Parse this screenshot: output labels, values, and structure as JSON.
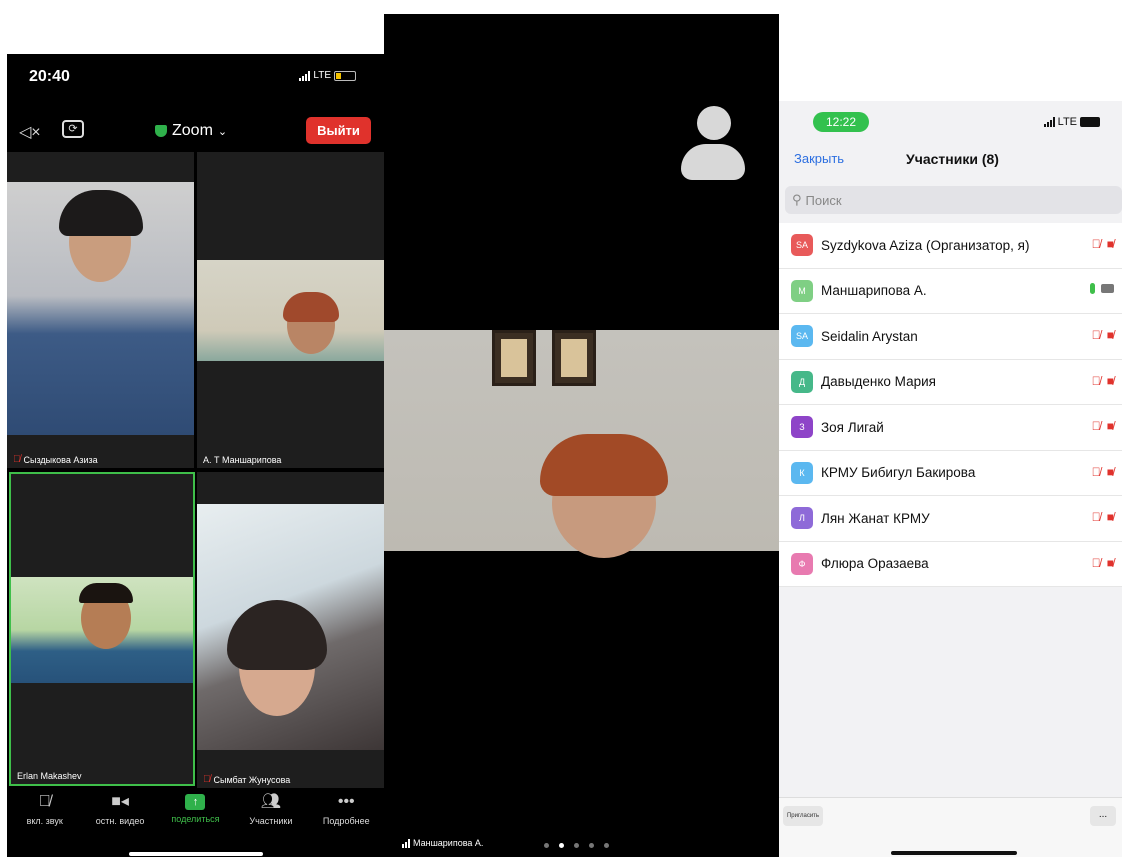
{
  "phone1": {
    "time": "20:40",
    "network": "LTE",
    "title": "Zoom",
    "leave_label": "Выйти",
    "tiles": [
      {
        "name": "Сыздыкова Азиза",
        "muted": true
      },
      {
        "name": "А. Т Маншарипова",
        "muted": false
      },
      {
        "name": "Erlan Makashev",
        "muted": false
      },
      {
        "name": "Сымбат Жунусова",
        "muted": true
      }
    ],
    "toolbar": {
      "unmute": "вкл. звук",
      "stop_video": "остн. видео",
      "share": "поделиться",
      "participants": "Участники",
      "more": "Подробнее"
    }
  },
  "phone2": {
    "speaker_name": "Маншарипова А."
  },
  "phone3": {
    "time": "12:22",
    "network": "LTE",
    "close_label": "Закрыть",
    "title": "Участники (8)",
    "search_placeholder": "Поиск",
    "participants": [
      {
        "initials": "SA",
        "name": "Syzdykova Aziza (Организатор, я)",
        "color": "#e85a5a"
      },
      {
        "initials": "М",
        "name": "Маншарипова А.",
        "color": "#7fcf84"
      },
      {
        "initials": "SA",
        "name": "Seidalin Arystan",
        "color": "#5bb8f0"
      },
      {
        "initials": "Д",
        "name": "Давыденко Мария",
        "color": "#46b889"
      },
      {
        "initials": "З",
        "name": "Зоя Лигай",
        "color": "#8e44c8"
      },
      {
        "initials": "К",
        "name": "КРМУ Бибигул Бакирова",
        "color": "#5bb8f0"
      },
      {
        "initials": "Л",
        "name": "Лян Жанат КРМУ",
        "color": "#8e6ad8"
      },
      {
        "initials": "Ф",
        "name": "Флюра Оразаева",
        "color": "#e87ab0"
      }
    ],
    "invite_label": "Пригласить",
    "more_label": "..."
  },
  "colors": {
    "zoom_green": "#2fb14b",
    "leave_red": "#e0322c",
    "link_blue": "#2d6fe0"
  }
}
